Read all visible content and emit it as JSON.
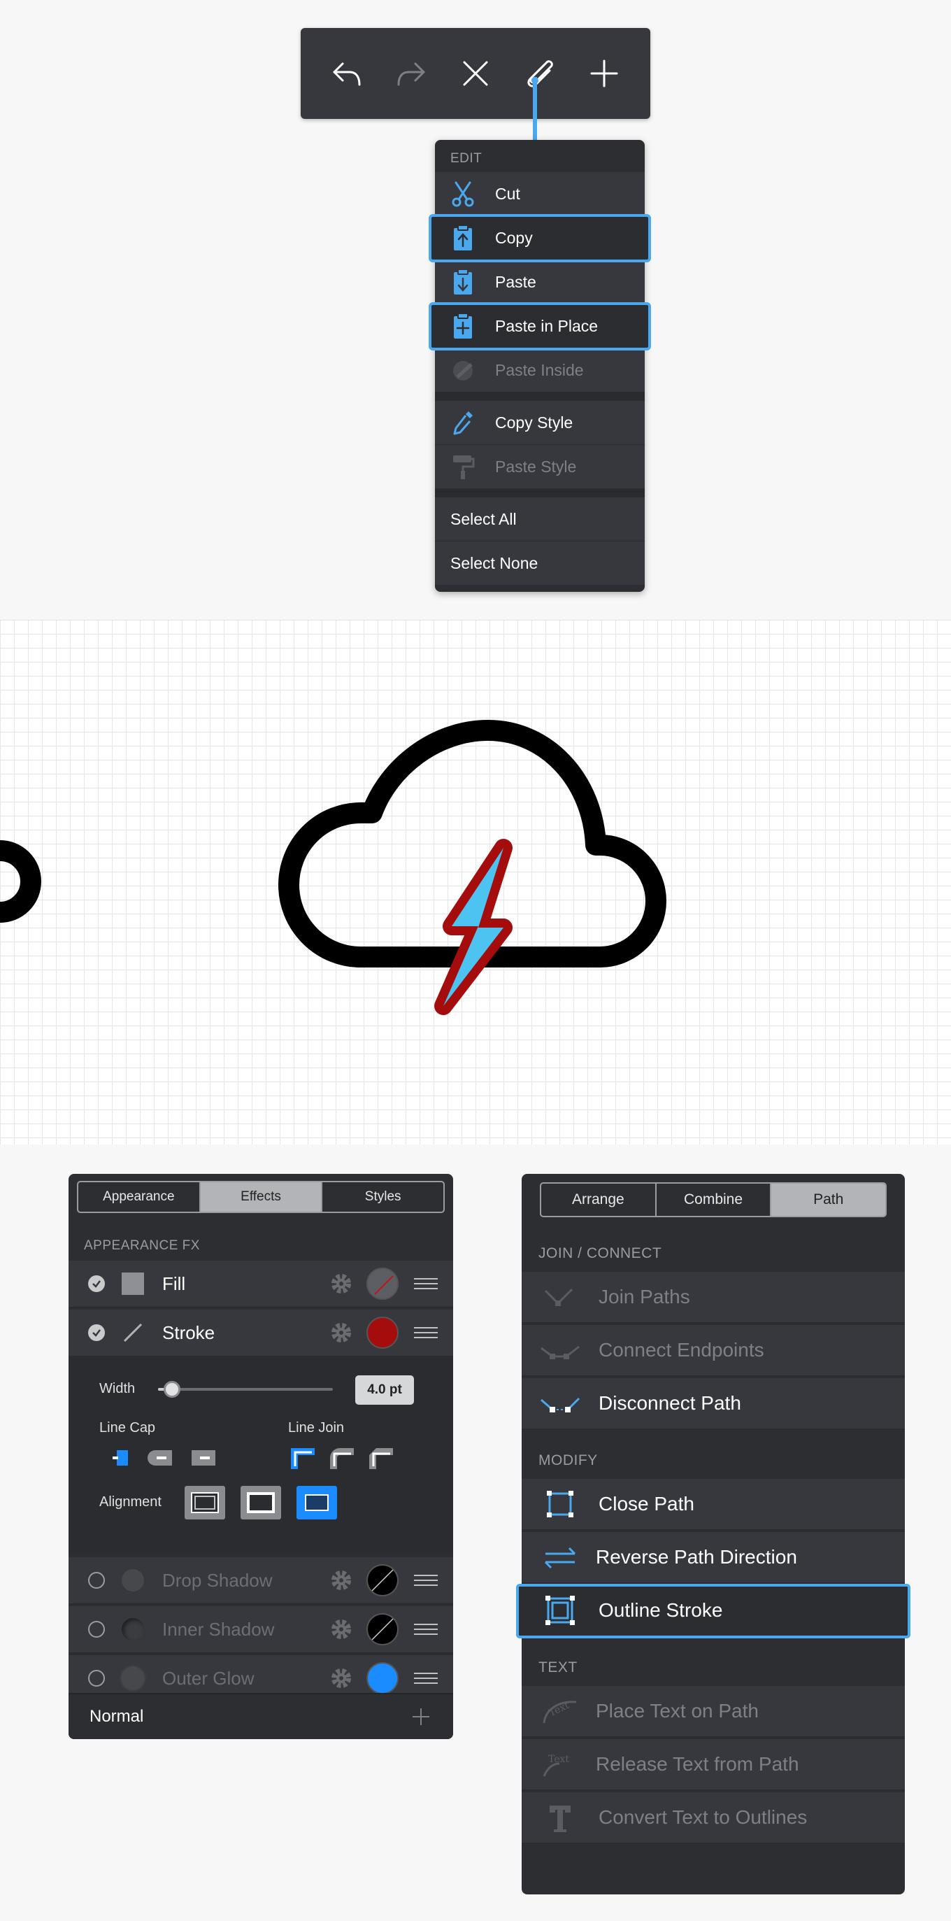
{
  "toolbar": {
    "buttons": [
      {
        "name": "undo-icon",
        "enabled": true
      },
      {
        "name": "redo-icon",
        "enabled": false
      },
      {
        "name": "close-icon",
        "enabled": true
      },
      {
        "name": "paperclip-icon",
        "enabled": true,
        "active": true
      },
      {
        "name": "plus-icon",
        "enabled": true
      }
    ]
  },
  "edit_menu": {
    "header": "EDIT",
    "items": [
      {
        "label": "Cut",
        "icon": "scissors-icon",
        "enabled": true,
        "highlighted": false
      },
      {
        "label": "Copy",
        "icon": "clipboard-copy-icon",
        "enabled": true,
        "highlighted": true
      },
      {
        "label": "Paste",
        "icon": "clipboard-paste-icon",
        "enabled": true,
        "highlighted": false
      },
      {
        "label": "Paste in Place",
        "icon": "clipboard-plus-icon",
        "enabled": true,
        "highlighted": true
      },
      {
        "label": "Paste Inside",
        "icon": "paste-inside-icon",
        "enabled": false,
        "highlighted": false
      },
      {
        "label": "Copy Style",
        "icon": "eyedropper-icon",
        "enabled": true,
        "highlighted": false
      },
      {
        "label": "Paste Style",
        "icon": "paint-roller-icon",
        "enabled": false,
        "highlighted": false
      },
      {
        "label": "Select All",
        "enabled": true
      },
      {
        "label": "Select None",
        "enabled": true
      }
    ]
  },
  "canvas": {
    "cloud_stroke_color": "#000000",
    "bolt_fill_color": "#4cc3f0",
    "bolt_stroke_color": "#a50d0d"
  },
  "appearance_panel": {
    "tabs": [
      "Appearance",
      "Effects",
      "Styles"
    ],
    "active_tab": "Effects",
    "section": "APPEARANCE FX",
    "effects": [
      {
        "name": "Fill",
        "checked": true,
        "color": "none"
      },
      {
        "name": "Stroke",
        "checked": true,
        "color": "#a50d0d"
      }
    ],
    "stroke_options": {
      "width_label": "Width",
      "width_value": "4.0 pt",
      "width_level": 0.08,
      "line_cap_label": "Line Cap",
      "line_join_label": "Line Join",
      "alignment_label": "Alignment"
    },
    "disabled_effects": [
      {
        "name": "Drop Shadow",
        "color": "#000000"
      },
      {
        "name": "Inner Shadow",
        "color": "#000000"
      },
      {
        "name": "Outer Glow",
        "color": "#1a8cff"
      }
    ],
    "blend_mode": "Normal",
    "accent": "#1a8cff"
  },
  "path_panel": {
    "tabs": [
      "Arrange",
      "Combine",
      "Path"
    ],
    "active_tab": "Path",
    "sections": [
      {
        "title": "JOIN / CONNECT",
        "items": [
          {
            "label": "Join Paths",
            "icon": "join-paths-icon",
            "enabled": false
          },
          {
            "label": "Connect Endpoints",
            "icon": "connect-endpoints-icon",
            "enabled": false
          },
          {
            "label": "Disconnect Path",
            "icon": "disconnect-path-icon",
            "enabled": true
          }
        ]
      },
      {
        "title": "MODIFY",
        "items": [
          {
            "label": "Close Path",
            "icon": "close-path-icon",
            "enabled": true
          },
          {
            "label": "Reverse Path Direction",
            "icon": "reverse-direction-icon",
            "enabled": true
          },
          {
            "label": "Outline Stroke",
            "icon": "outline-stroke-icon",
            "enabled": true,
            "highlighted": true
          }
        ]
      },
      {
        "title": "TEXT",
        "items": [
          {
            "label": "Place Text on Path",
            "icon": "text-on-path-icon",
            "enabled": false
          },
          {
            "label": "Release Text from Path",
            "icon": "release-text-icon",
            "enabled": false
          },
          {
            "label": "Convert Text to Outlines",
            "icon": "text-outlines-icon",
            "enabled": false
          }
        ]
      }
    ]
  }
}
